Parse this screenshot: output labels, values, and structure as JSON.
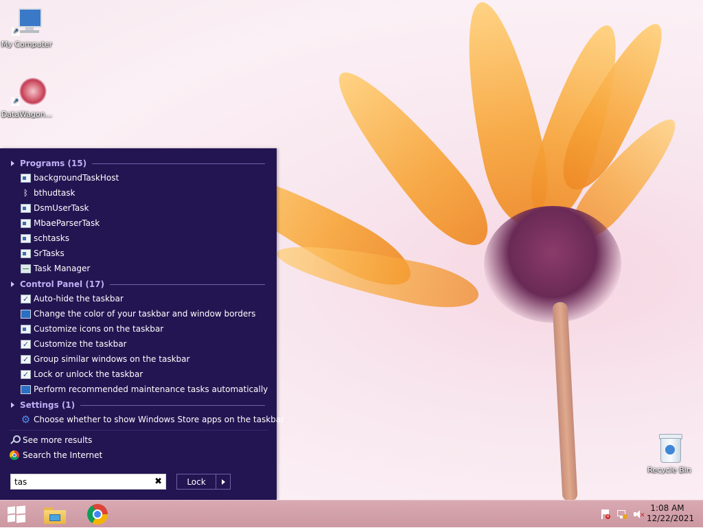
{
  "desktop": {
    "icons": [
      {
        "label": "My Computer",
        "icon": "computer-icon"
      },
      {
        "label": "DataWagon...",
        "icon": "datawagon-icon"
      },
      {
        "label": "Recycle Bin",
        "icon": "recycle-bin-icon"
      }
    ]
  },
  "start_menu": {
    "groups": [
      {
        "title": "Programs (15)",
        "items": [
          {
            "label": "backgroundTaskHost",
            "icon": "window-icon"
          },
          {
            "label": "bthudtask",
            "icon": "bluetooth-icon"
          },
          {
            "label": "DsmUserTask",
            "icon": "window-icon"
          },
          {
            "label": "MbaeParserTask",
            "icon": "window-icon"
          },
          {
            "label": "schtasks",
            "icon": "window-icon"
          },
          {
            "label": "SrTasks",
            "icon": "window-icon"
          },
          {
            "label": "Task Manager",
            "icon": "task-manager-icon"
          }
        ]
      },
      {
        "title": "Control Panel (17)",
        "items": [
          {
            "label": "Auto-hide the taskbar",
            "icon": "checkbox-icon"
          },
          {
            "label": "Change the color of your taskbar and window borders",
            "icon": "monitor-icon"
          },
          {
            "label": "Customize icons on the taskbar",
            "icon": "taskbar-settings-icon"
          },
          {
            "label": "Customize the taskbar",
            "icon": "checkbox-icon"
          },
          {
            "label": "Group similar windows on the taskbar",
            "icon": "checkbox-icon"
          },
          {
            "label": "Lock or unlock the taskbar",
            "icon": "checkbox-icon"
          },
          {
            "label": "Perform recommended maintenance tasks automatically",
            "icon": "maintenance-icon"
          }
        ]
      },
      {
        "title": "Settings (1)",
        "items": [
          {
            "label": "Choose whether to show Windows Store apps on the taskbar",
            "icon": "gear-icon"
          }
        ]
      }
    ],
    "see_more": "See more results",
    "search_internet": "Search the Internet",
    "search": {
      "value": "tas",
      "clear_symbol": "✖"
    },
    "lock_label": "Lock"
  },
  "taskbar": {
    "start_icon": "windows-logo-icon",
    "pinned": [
      "file-explorer-icon",
      "chrome-icon"
    ],
    "tray": [
      "action-center-flag-icon",
      "network-icon",
      "volume-muted-icon"
    ],
    "clock": {
      "time": "1:08 AM",
      "date": "12/22/2021"
    }
  },
  "colors": {
    "menu_bg": "#231552",
    "group_title": "#bfb0f5",
    "taskbar": "#cf9ca6"
  }
}
